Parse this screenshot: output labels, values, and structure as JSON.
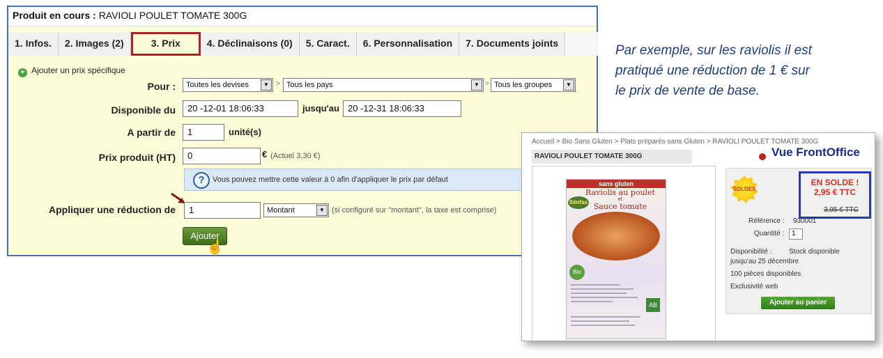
{
  "backoffice": {
    "title_label": "Produit en cours :",
    "title_value": "RAVIOLI POULET TOMATE 300G",
    "tabs": [
      {
        "label": "1. Infos."
      },
      {
        "label": "2. Images (2)"
      },
      {
        "label": "3. Prix"
      },
      {
        "label": "4. Déclinaisons (0)"
      },
      {
        "label": "5. Caract."
      },
      {
        "label": "6. Personnalisation"
      },
      {
        "label": "7. Documents joints"
      }
    ],
    "active_tab": "3. Prix",
    "add_specific_price": "Ajouter un prix spécifique",
    "pour_label": "Pour :",
    "currency_select": "Toutes les devises",
    "country_select": "Tous les pays",
    "group_select": "Tous les groupes",
    "separator": ">",
    "available_label": "Disponible du",
    "date_from": "20  -12-01 18:06:33",
    "until_label": "jusqu'au",
    "date_to": "20  -12-31 18:06:33",
    "from_qty_label": "A partir de",
    "from_qty_value": "1",
    "unit_label": "unité(s)",
    "price_label": "Prix produit (HT)",
    "price_value": "0",
    "currency_symbol": "€",
    "current_price_hint": "(Actuel 3,30 €)",
    "info_text": "Vous pouvez mettre cette valeur à 0 afin d'appliquer le prix par défaut",
    "reduction_label": "Appliquer une réduction de",
    "reduction_value": "1",
    "reduction_type": "Montant",
    "reduction_hint": "(si configuré sur \"montant\", la taxe est comprise)",
    "add_button": "Ajouter"
  },
  "note": {
    "line1": "Par exemple, sur les raviolis il est",
    "line2": "pratiqué une réduction de 1 € sur",
    "line3": "le prix de vente de base."
  },
  "frontoffice": {
    "breadcrumb": "Accueil > Bio Sans Gluten > Plats préparés sans Gluten > RAVIOLI POULET TOMATE 300G",
    "product_title": "RAVIOLI POULET TOMATE 300G",
    "view_label": "Vue FrontOffice",
    "package": {
      "band": "sans gluten",
      "name_line1": "Raviolis au poulet",
      "name_line2": "et",
      "name_line3": "Sauce tomate",
      "logo": "Sénfas",
      "bio": "Bio",
      "ab": "AB"
    },
    "sale_badge": "SOLDES",
    "sale_line1": "EN SOLDE !",
    "sale_line2": "2,95 € TTC",
    "old_price": "3,95 € TTC",
    "reference_label": "Référence :",
    "reference_value": "930001",
    "quantity_label": "Quantité :",
    "quantity_value": "1",
    "availability_label": "Disponibilité :",
    "availability_value": "Stock disponible",
    "availability_until": "jusqu'au 25 décembre",
    "pieces": "100 pièces disponibles",
    "exclusive": "Exclusivité web",
    "cart_button": "Ajouter au panier"
  }
}
